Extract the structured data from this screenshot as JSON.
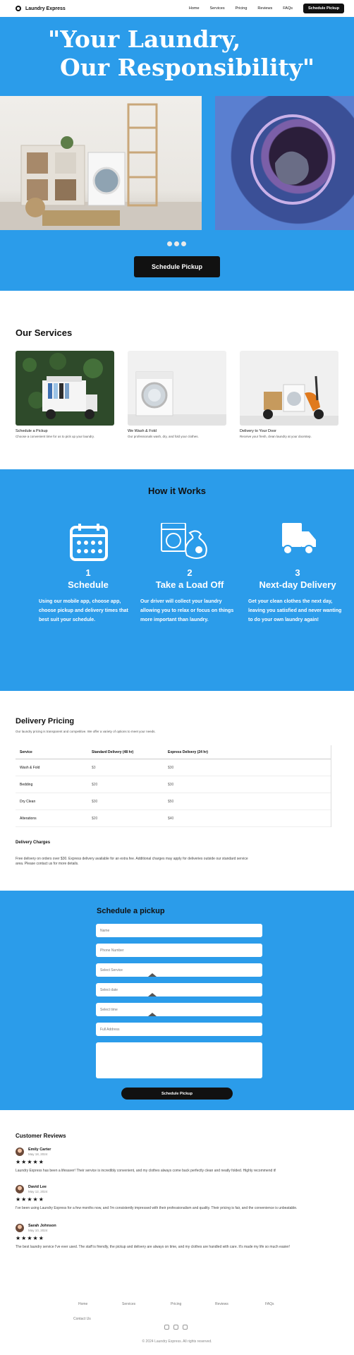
{
  "nav": {
    "brand": "Laundry Express",
    "links": [
      "Home",
      "Services",
      "Pricing",
      "Reviews",
      "FAQs"
    ],
    "cta": "Schedule Pickup"
  },
  "hero": {
    "title_line1": "\"Your Laundry,",
    "title_line2": "Our Responsibility\"",
    "cta": "Schedule Pickup"
  },
  "services": {
    "title": "Our Services",
    "items": [
      {
        "name": "Schedule a Pickup",
        "desc": "Choose a convenient time for us to pick up your laundry."
      },
      {
        "name": "We Wash & Fold",
        "desc": "Our professionals wash, dry, and fold your clothes."
      },
      {
        "name": "Delivery to Your Door",
        "desc": "Receive your fresh, clean laundry at your doorstep."
      }
    ]
  },
  "how": {
    "title": "How it Works",
    "steps": [
      {
        "num": "1",
        "name": "Schedule",
        "desc": "Using our mobile app, choose app, choose pickup and delivery times that best suit your schedule."
      },
      {
        "num": "2",
        "name": "Take a Load Off",
        "desc": "Our driver will collect your laundry allowing you to relax or focus on things more important than laundry."
      },
      {
        "num": "3",
        "name": "Next-day Delivery",
        "desc": "Get your clean clothes the next day, leaving you satisfied and never wanting to do your own laundry again!"
      }
    ]
  },
  "pricing": {
    "title": "Delivery Pricing",
    "subtitle": "Our laundry pricing is transparent and competitive. We offer a variety of options to meet your needs.",
    "headers": [
      "Service",
      "Standard Delivery (48 hr)",
      "Express Delivery (24 hr)"
    ],
    "rows": [
      [
        "Wash & Fold",
        "$3",
        "$30"
      ],
      [
        "Bedding",
        "$20",
        "$30"
      ],
      [
        "Dry Clean",
        "$30",
        "$50"
      ],
      [
        "Alterations",
        "$20",
        "$40"
      ]
    ],
    "charges_title": "Delivery Charges",
    "charges_text": "Free delivery on orders over $30. Express delivery available for an extra fee. Additional charges may apply for deliveries outside our standard service area. Please contact us for more details."
  },
  "schedule": {
    "title": "Schedule a pickup",
    "fields": {
      "name": "Name",
      "phone": "Phone Number",
      "service": "Select Service",
      "date": "Select date",
      "time": "Select time",
      "address": "Full Address",
      "notes": ""
    },
    "cta": "Schedule Pickup"
  },
  "reviews": {
    "title": "Customer Reviews",
    "items": [
      {
        "name": "Emily Carter",
        "date": "May 18, 2024",
        "stars": "★★★★★",
        "text": "Laundry Express has been a lifesaver! Their service is incredibly convenient, and my clothes always come back perfectly clean and neatly folded. Highly recommend it!"
      },
      {
        "name": "David Lee",
        "date": "May 12, 2024",
        "stars": "★★★★★",
        "text": "I've been using Laundry Express for a few months now, and I'm consistently impressed with their professionalism and quality. Their pricing is fair, and the convenience is unbeatable."
      },
      {
        "name": "Sarah Johnson",
        "date": "May 10, 2024",
        "stars": "★★★★★",
        "text": "The best laundry service I've ever used. The staff is friendly, the pickup and delivery are always on time, and my clothes are handled with care. It's made my life so much easier!"
      }
    ]
  },
  "footer": {
    "links": [
      "Home",
      "Services",
      "Pricing",
      "Reviews",
      "FAQs",
      "Contact Us"
    ],
    "copyright": "© 2024 Laundry Express. All rights reserved."
  },
  "colors": {
    "brand_blue": "#2b9cea",
    "dark": "#111111"
  }
}
